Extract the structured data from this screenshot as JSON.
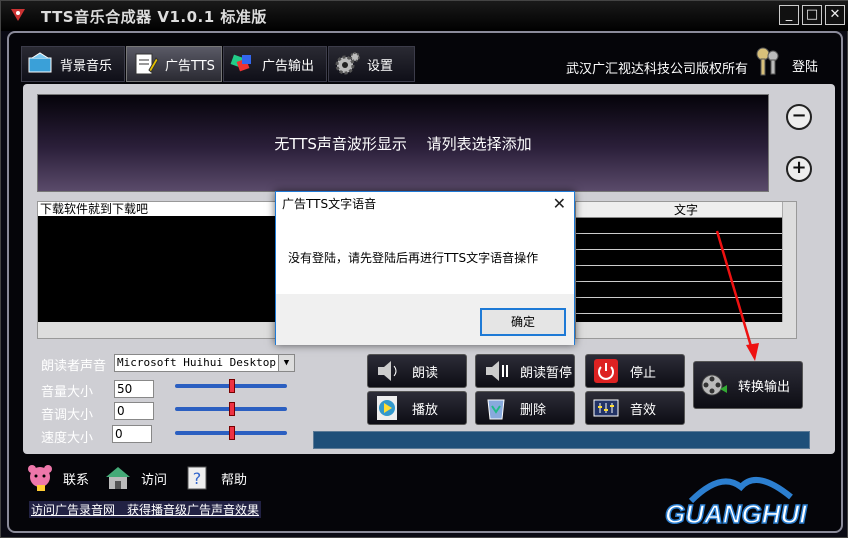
{
  "window": {
    "title": "TTS音乐合成器 V1.0.1 标准版",
    "min_label": "_",
    "max_label": "□",
    "close_label": "✕"
  },
  "tabs": [
    {
      "label": "背景音乐",
      "icon": "music-box-icon"
    },
    {
      "label": "广告TTS",
      "icon": "notepad-icon"
    },
    {
      "label": "广告输出",
      "icon": "export-icon"
    },
    {
      "label": "设置",
      "icon": "gear-icon"
    }
  ],
  "header": {
    "copyright": "武汉广汇视达科技公司版权所有",
    "login_label": "登陆"
  },
  "wave": {
    "message": "无TTS声音波形显示　 请列表选择添加"
  },
  "zoom": {
    "out": "−",
    "in": "+"
  },
  "left_list": {
    "items": [
      "下载软件就到下载吧"
    ]
  },
  "right_list": {
    "column_header": "文字"
  },
  "controls": {
    "voice_label": "朗读者声音",
    "voice_value": "Microsoft Huihui Desktop -",
    "volume_label": "音量大小",
    "volume_value": "50",
    "pitch_label": "音调大小",
    "pitch_value": "0",
    "speed_label": "速度大小",
    "speed_value": "0"
  },
  "actions": {
    "read": "朗读",
    "pause": "朗读暂停",
    "stop": "停止",
    "play": "播放",
    "delete": "删除",
    "effect": "音效",
    "convert": "转换输出"
  },
  "footer": {
    "contact": "联系",
    "visit": "访问",
    "help": "帮助",
    "marquee": "访问广告录音网　获得播音级广告声音效果"
  },
  "logo": {
    "text": "GUANGHUI"
  },
  "dialog": {
    "title": "广告TTS文字语音",
    "message": "没有登陆，请先登陆后再进行TTS文字语音操作",
    "ok_label": "确定",
    "close_label": "✕"
  },
  "colors": {
    "accent": "#1e7ad6",
    "slider": "#2b5fc1",
    "progress": "#1e4f79"
  }
}
